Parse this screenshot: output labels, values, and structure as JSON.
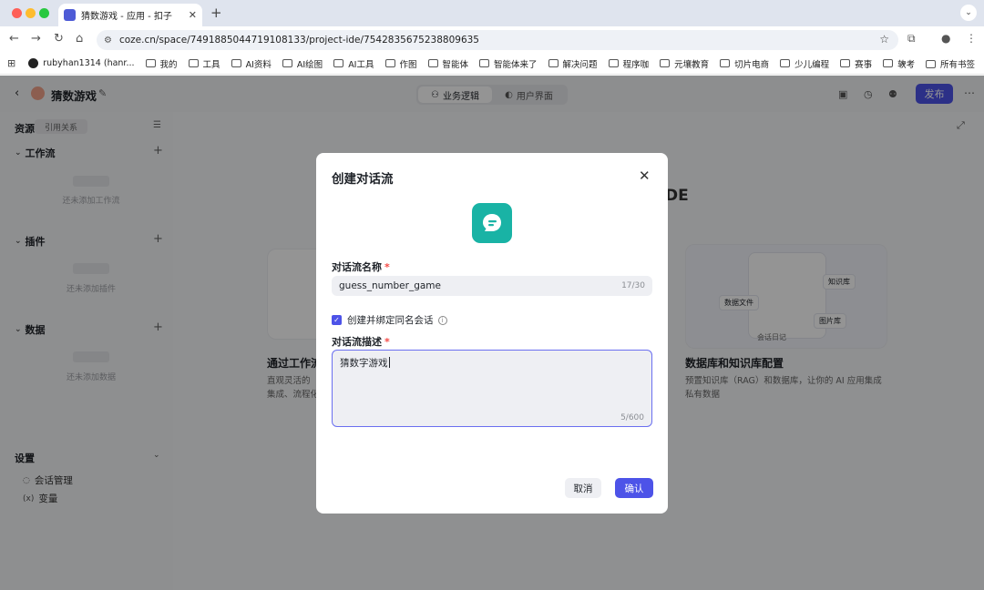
{
  "browser": {
    "tab_title": "猜数游戏 - 应用 - 扣子",
    "url": "coze.cn/space/7491885044719108133/project-ide/7542835675238809635",
    "bookmarks": [
      "rubyhan1314 (hanr...",
      "我的",
      "工具",
      "AI资料",
      "AI绘图",
      "AI工具",
      "作图",
      "智能体",
      "智能体来了",
      "解决问题",
      "程序咖",
      "元壤教育",
      "切片电商",
      "少儿编程",
      "赛事",
      "软考"
    ],
    "bookmarks_more": "»",
    "all_bookmarks": "所有书签"
  },
  "app": {
    "project_name": "猜数游戏",
    "tabs": [
      "业务逻辑",
      "用户界面"
    ],
    "publish_label": "发布"
  },
  "sidebar": {
    "title": "资源",
    "chip": "引用关系",
    "sections": [
      {
        "label": "工作流",
        "empty": "还未添加工作流"
      },
      {
        "label": "插件",
        "empty": "还未添加插件"
      },
      {
        "label": "数据",
        "empty": "还未添加数据"
      }
    ],
    "settings_label": "设置",
    "settings_items": [
      "会话管理",
      "变量"
    ]
  },
  "main": {
    "heading_fragment": "DE",
    "feature_left_title": "通过工作流",
    "feature_left_desc": [
      "直观灵活的",
      "集成、流程化"
    ],
    "feature_right_title": "数据库和知识库配置",
    "feature_right_desc": [
      "预置知识库（RAG）和数据库，让你的 AI 应用集成",
      "私有数据"
    ],
    "illus_tags": [
      "知识库",
      "数据文件",
      "图片库",
      "会话日记"
    ]
  },
  "modal": {
    "title": "创建对话流",
    "name_label": "对话流名称",
    "name_value": "guess_number_game",
    "name_count": "17/30",
    "checkbox_label": "创建并绑定同名会话",
    "checkbox_checked": true,
    "desc_label": "对话流描述",
    "desc_value": "猜数字游戏",
    "desc_count": "5/600",
    "cancel_label": "取消",
    "confirm_label": "确认",
    "icon": "chat-bubble-icon",
    "accent": "#4d53e8",
    "icon_bg": "#19b3a5"
  }
}
